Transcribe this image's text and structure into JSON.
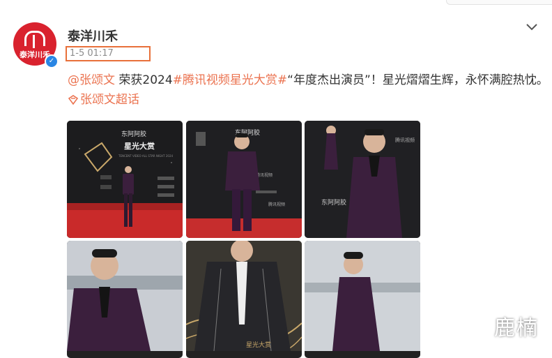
{
  "post": {
    "avatar_brand": "泰洋川禾",
    "username": "泰洋川禾",
    "timestamp": "1-5 01:17",
    "text": {
      "mention": "@张颂文",
      "part1": " 荣获2024",
      "hashtag": "#腾讯视频星光大赏#",
      "part2": "“年度杰出演员”！星光熠熠生辉，永怀满腔热忱。",
      "topic_link": "张颂文超话"
    },
    "photos": [
      {
        "name": "photo-1"
      },
      {
        "name": "photo-2"
      },
      {
        "name": "photo-3"
      },
      {
        "name": "photo-4"
      },
      {
        "name": "photo-5"
      },
      {
        "name": "photo-6"
      }
    ],
    "photo_texts": {
      "sponsor": "东阿阿胶",
      "event": "星光大赏",
      "event_en": "TENCENT VIDEO ALL STAR NIGHT 2024",
      "platform": "腾讯视频"
    }
  },
  "watermark": "鹿楠",
  "icons": {
    "more": "chevron-down-icon",
    "verified": "verified-badge-icon",
    "topic": "supertopic-icon"
  },
  "colors": {
    "link": "#eb7350",
    "highlight_box": "#e8703a",
    "avatar_bg": "#d9222e",
    "verified": "#2a86e4",
    "suit": "#3b1f3d"
  }
}
